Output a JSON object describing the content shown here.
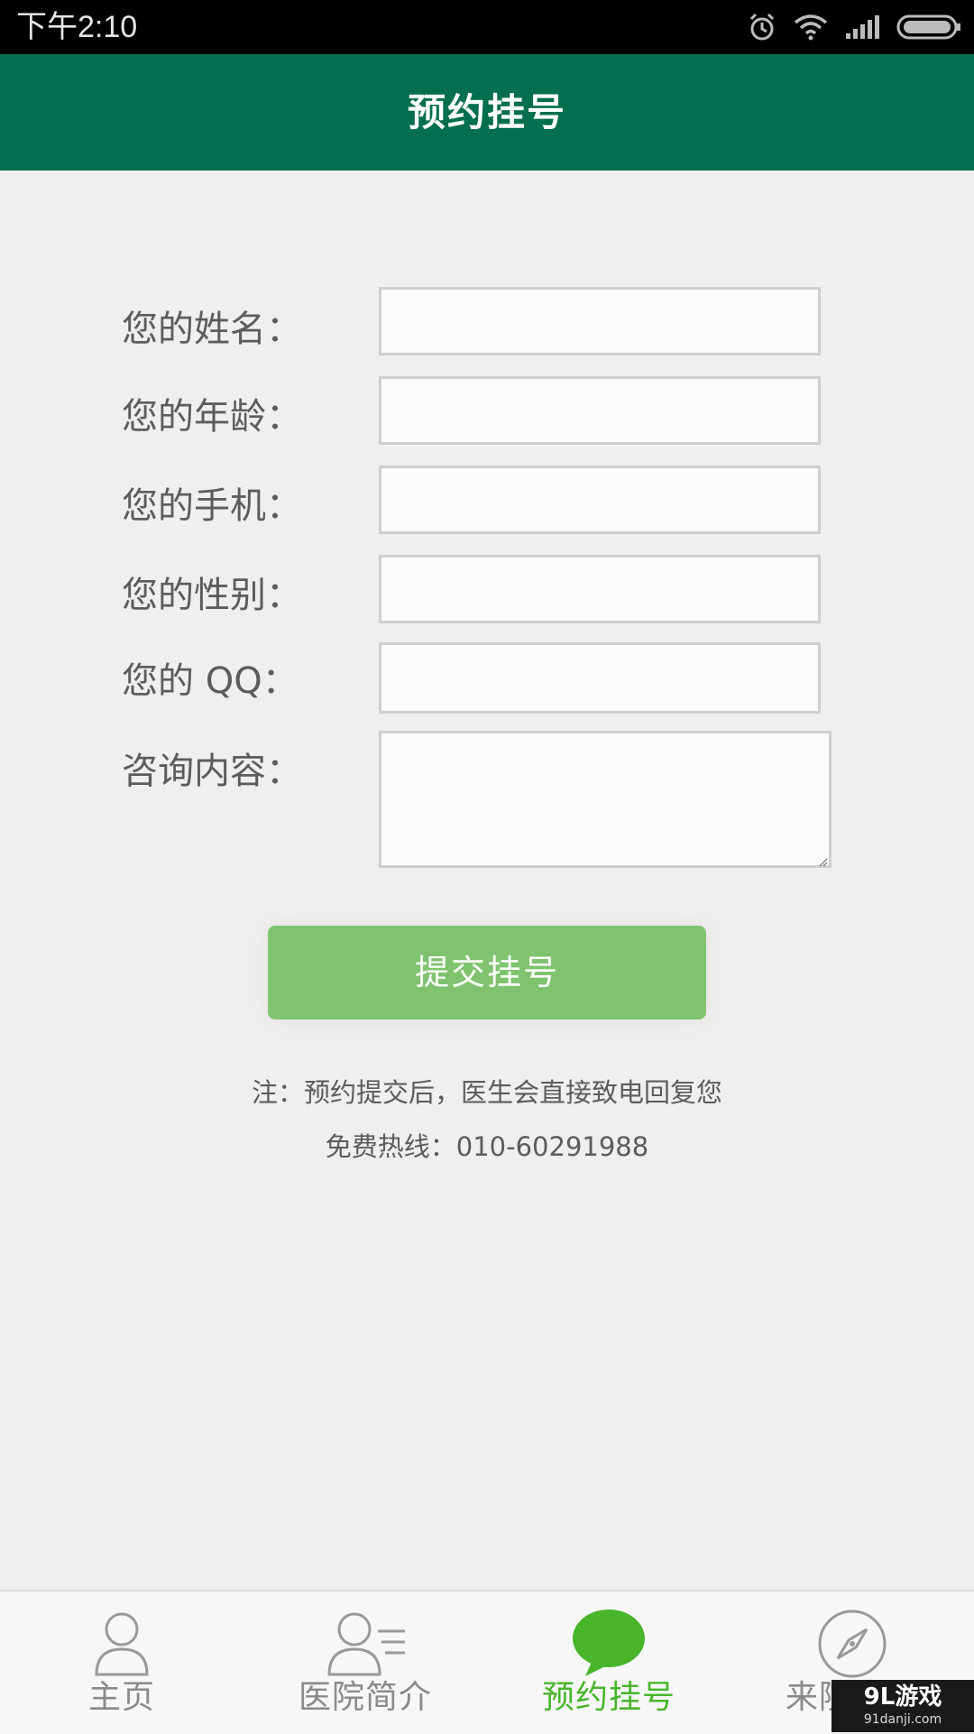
{
  "status_bar": {
    "time": "下午2:10",
    "icons": [
      "alarm-icon",
      "wifi-icon",
      "signal-icon",
      "battery-icon"
    ]
  },
  "header": {
    "title": "预约挂号"
  },
  "form": {
    "fields": [
      {
        "label": "您的姓名：",
        "value": ""
      },
      {
        "label": "您的年龄：",
        "value": ""
      },
      {
        "label": "您的手机：",
        "value": ""
      },
      {
        "label": "您的性别：",
        "value": ""
      },
      {
        "label": "您的 QQ：",
        "value": ""
      },
      {
        "label": "咨询内容：",
        "value": ""
      }
    ],
    "submit_label": "提交挂号",
    "note": "注：预约提交后，医生会直接致电回复您",
    "hotline": "免费热线：010-60291988"
  },
  "bottom_nav": {
    "items": [
      {
        "label": "主页",
        "icon": "person-icon",
        "active": false
      },
      {
        "label": "医院简介",
        "icon": "person-list-icon",
        "active": false
      },
      {
        "label": "预约挂号",
        "icon": "chat-bubble-icon",
        "active": true
      },
      {
        "label": "来院路线",
        "icon": "compass-icon",
        "active": false
      }
    ]
  },
  "watermark": {
    "main": "9L游戏",
    "sub": "91danji.com"
  },
  "colors": {
    "header_bg": "#046f4e",
    "page_bg": "#f1efed",
    "button_bg": "#80c36f",
    "nav_active": "#48b52b",
    "nav_inactive": "#8a8a8a"
  }
}
